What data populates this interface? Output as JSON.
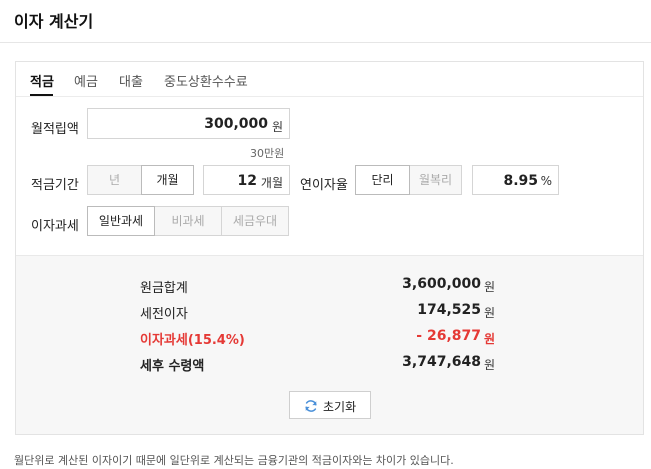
{
  "page": {
    "title": "이자 계산기"
  },
  "tabs": [
    {
      "label": "적금",
      "active": true
    },
    {
      "label": "예금",
      "active": false
    },
    {
      "label": "대출",
      "active": false
    },
    {
      "label": "중도상환수수료",
      "active": false
    }
  ],
  "form": {
    "monthly_label": "월적립액",
    "monthly_value": "300,000",
    "monthly_unit": "원",
    "monthly_hint": "30만원",
    "period_label": "적금기간",
    "period_options": [
      "년",
      "개월"
    ],
    "period_selected": "개월",
    "period_value": "12",
    "period_unit": "개월",
    "rate_label": "연이자율",
    "rate_options": [
      "단리",
      "월복리"
    ],
    "rate_selected": "단리",
    "rate_value": "8.95",
    "rate_unit": "%",
    "tax_label": "이자과세",
    "tax_options": [
      "일반과세",
      "비과세",
      "세금우대"
    ],
    "tax_selected": "일반과세"
  },
  "results": {
    "rows": [
      {
        "label": "원금합계",
        "value": "3,600,000",
        "unit": "원"
      },
      {
        "label": "세전이자",
        "value": "174,525",
        "unit": "원"
      },
      {
        "label": "이자과세(15.4%)",
        "value": "- 26,877",
        "unit": "원"
      },
      {
        "label": "세후 수령액",
        "value": "3,747,648",
        "unit": "원"
      }
    ],
    "reset_label": "초기화"
  },
  "footnote": "월단위로 계산된 이자이기 때문에 일단위로 계산되는 금융기관의 적금이자와는 차이가 있습니다.",
  "colors": {
    "accent_red": "#e53935",
    "reset_icon": "#4a90d9"
  },
  "icons": {
    "reset": "refresh-icon"
  }
}
